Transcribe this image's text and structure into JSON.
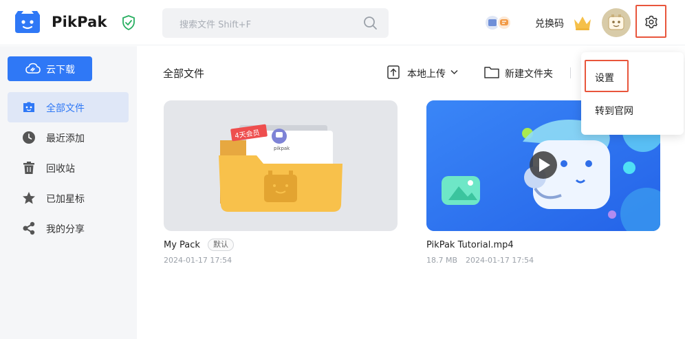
{
  "header": {
    "brand": "PikPak",
    "search_placeholder": "搜索文件 Shift+F",
    "redeem_label": "兑换码"
  },
  "sidebar": {
    "cloud_download_label": "云下载",
    "items": [
      {
        "label": "全部文件",
        "icon": "folder-bot-icon",
        "active": true
      },
      {
        "label": "最近添加",
        "icon": "clock-icon",
        "active": false
      },
      {
        "label": "回收站",
        "icon": "trash-icon",
        "active": false
      },
      {
        "label": "已加星标",
        "icon": "star-icon",
        "active": false
      },
      {
        "label": "我的分享",
        "icon": "share-icon",
        "active": false
      }
    ]
  },
  "main": {
    "title": "全部文件",
    "upload_label": "本地上传",
    "new_folder_label": "新建文件夹",
    "files": [
      {
        "name": "My Pack",
        "badge": "默认",
        "size": "",
        "date": "2024-01-17 17:54",
        "thumb_text": "4天会员",
        "thumb_subtext": "pikpak"
      },
      {
        "name": "PikPak Tutorial.mp4",
        "badge": "",
        "size": "18.7 MB",
        "date": "2024-01-17 17:54"
      }
    ]
  },
  "dropdown": {
    "items": [
      {
        "label": "设置",
        "highlighted": true
      },
      {
        "label": "转到官网",
        "highlighted": false
      }
    ]
  },
  "colors": {
    "accent": "#2f78f6",
    "highlight": "#e8553b",
    "sidebar_bg": "#f5f6f8",
    "active_bg": "#dfe7f7",
    "shield": "#27ae60",
    "crown": "#f5c04a"
  }
}
